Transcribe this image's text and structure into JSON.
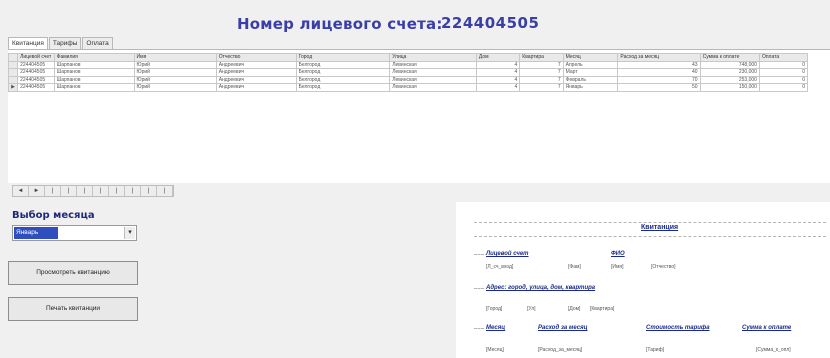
{
  "header": {
    "title": "Номер лицевого счета:",
    "account_number": "224404505"
  },
  "tabs": [
    {
      "label": "Квитанция"
    },
    {
      "label": "Тарифы"
    },
    {
      "label": "Оплата"
    }
  ],
  "grid": {
    "columns": [
      "Лицевой счет",
      "Фамилия",
      "Имя",
      "Отчество",
      "Город",
      "Улица",
      "Дом",
      "Квартира",
      "Месяц",
      "Расход за месяц",
      "Сумма к оплате",
      "Оплата"
    ],
    "rows": [
      [
        "224404505",
        "Шарпанов",
        "Юрий",
        "Андреевич",
        "Белгород",
        "Левинская",
        "4",
        "7",
        "Апрель",
        "43",
        "748,000",
        "0"
      ],
      [
        "224404505",
        "Шарпанов",
        "Юрий",
        "Андреевич",
        "Белгород",
        "Левинская",
        "4",
        "7",
        "Март",
        "40",
        "230,000",
        "0"
      ],
      [
        "224404505",
        "Шарпанов",
        "Юрий",
        "Андреевич",
        "Белгород",
        "Левинская",
        "4",
        "7",
        "Февраль",
        "70",
        "253,000",
        "0"
      ],
      [
        "224404505",
        "Шарпанов",
        "Юрий",
        "Андреевич",
        "Белгород",
        "Левинская",
        "4",
        "7",
        "Январь",
        "50",
        "150,000",
        "0"
      ]
    ]
  },
  "navbar": {
    "buttons": [
      "◄",
      "►",
      "|",
      "|",
      "|",
      "|",
      "|",
      "|",
      "|",
      "|"
    ]
  },
  "month": {
    "label": "Выбор месяца",
    "selected": "Январь",
    "arrow": "▾"
  },
  "buttons": {
    "view": "Просмотреть квитанцию",
    "print": "Печать квитанции"
  },
  "receipt": {
    "title": "Квитанция",
    "account_label": "Лицевой счет",
    "fio_label": "ФИО",
    "account_field": "[Л_сч_вход]",
    "fam_field": "[Фам]",
    "name_field": "[Имя]",
    "otch_field": "[Отчество]",
    "address_label": "Адрес: город, улица, дом, квартира",
    "city_field": "[Город]",
    "street_field": "[Ул]",
    "house_field": "[Дом]",
    "flat_field": "[Квартира]",
    "month_label": "Месяц",
    "usage_label": "Расход за месяц",
    "tariff_label": "Стоимость тарифа",
    "sum_label": "Сумма к оплате",
    "month_field": "[Месяц]",
    "usage_field": "[Расход_за_месяц]",
    "tariff_field": "[Тариф]",
    "sum_field": "[Сумма_к_опл]"
  }
}
